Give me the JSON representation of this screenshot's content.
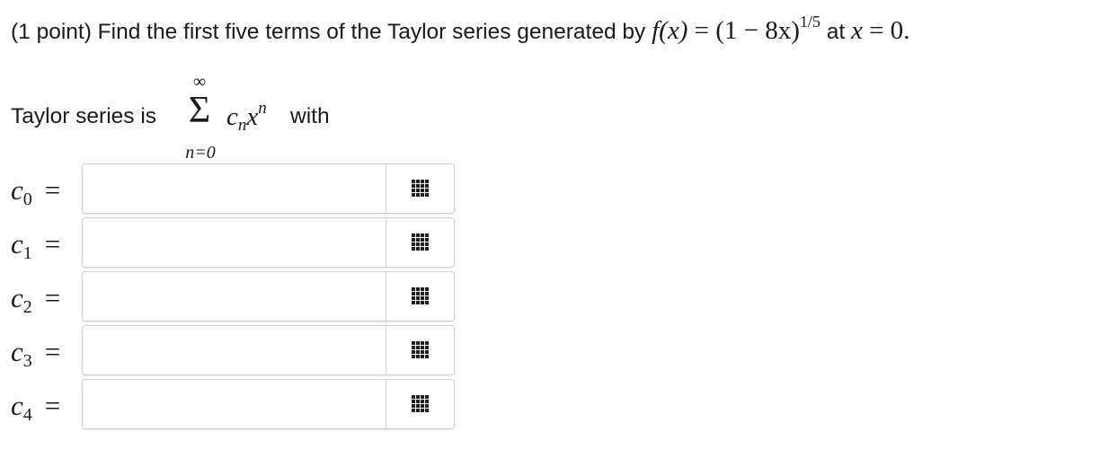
{
  "problem": {
    "prefix": "(1 point) Find the first five terms of the Taylor series generated by ",
    "func_lhs": "f(x)",
    "func_eq": " = (1 − 8x)",
    "func_exp": "1/5",
    "mid": " at ",
    "point_var": "x",
    "point_val": " = 0",
    "suffix": "."
  },
  "series": {
    "intro": "Taylor series is",
    "upper": "∞",
    "sigma": "Σ",
    "lower": "n=0",
    "coef_base": "c",
    "coef_sub": "n",
    "var_base": "x",
    "var_sup": "n",
    "after": "with"
  },
  "answers": [
    {
      "label": "c",
      "sub": "0",
      "eq": "=",
      "value": "",
      "icon": "grid-icon"
    },
    {
      "label": "c",
      "sub": "1",
      "eq": "=",
      "value": "",
      "icon": "grid-icon"
    },
    {
      "label": "c",
      "sub": "2",
      "eq": "=",
      "value": "",
      "icon": "grid-icon"
    },
    {
      "label": "c",
      "sub": "3",
      "eq": "=",
      "value": "",
      "icon": "grid-icon"
    },
    {
      "label": "c",
      "sub": "4",
      "eq": "=",
      "value": "",
      "icon": "grid-icon"
    }
  ]
}
